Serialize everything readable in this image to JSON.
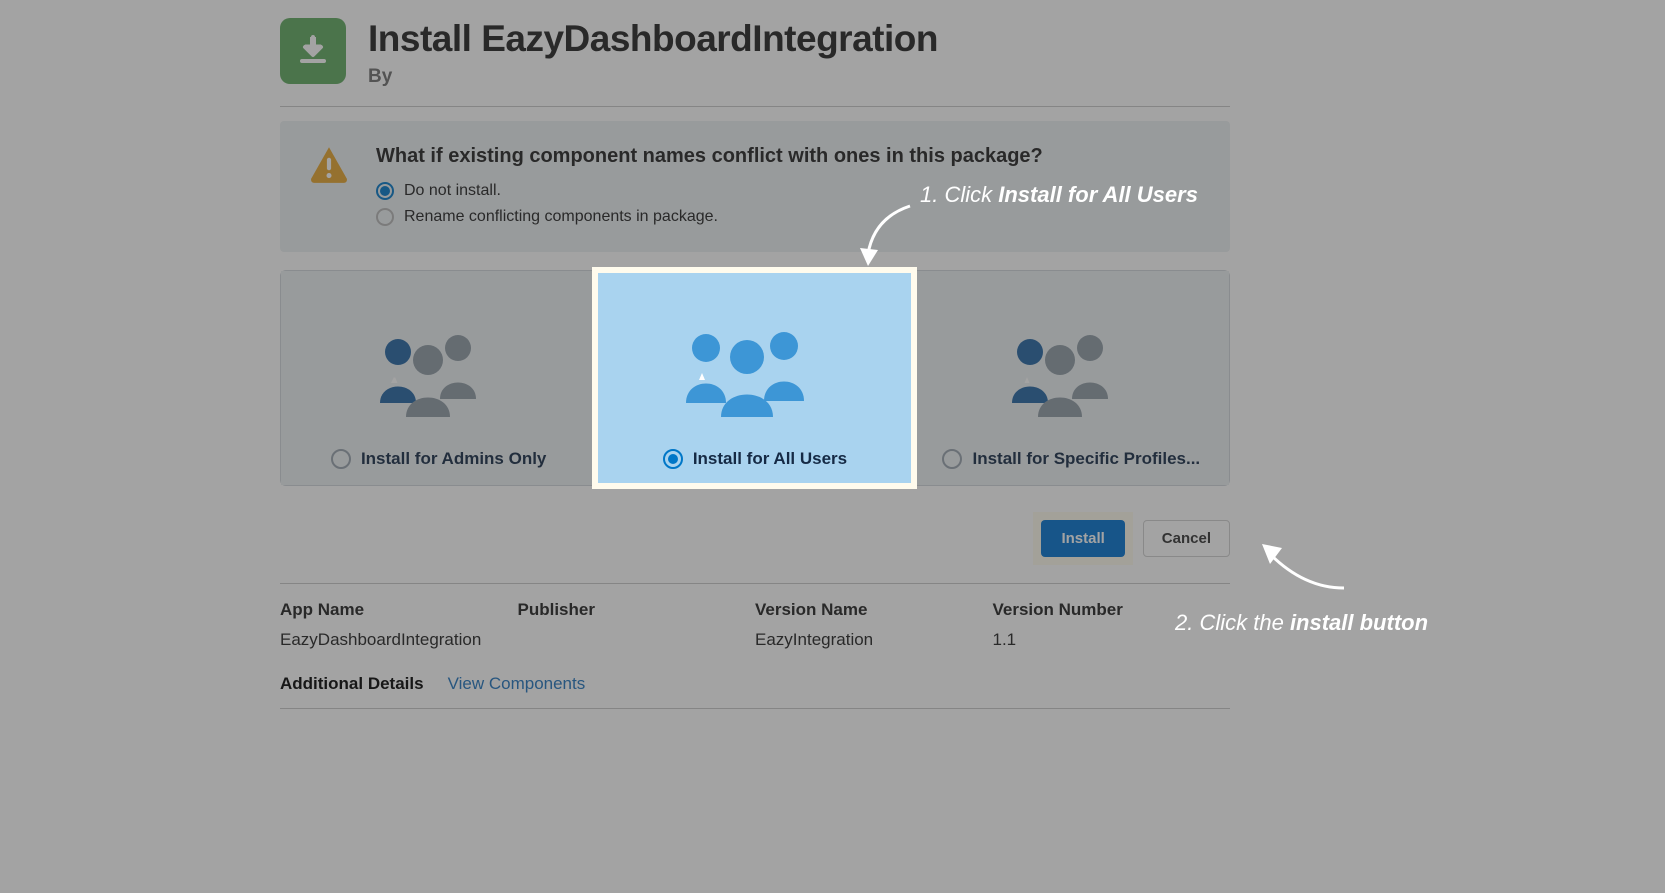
{
  "header": {
    "title": "Install EazyDashboardIntegration",
    "byline": "By"
  },
  "conflict": {
    "question": "What if existing component names conflict with ones in this package?",
    "options": [
      {
        "label": "Do not install.",
        "selected": true
      },
      {
        "label": "Rename conflicting components in package.",
        "selected": false
      }
    ]
  },
  "cards": [
    {
      "label": "Install for Admins Only"
    },
    {
      "label": "Install for All Users"
    },
    {
      "label": "Install for Specific Profiles..."
    }
  ],
  "actions": {
    "install": "Install",
    "cancel": "Cancel"
  },
  "details": {
    "cols": [
      {
        "label": "App Name",
        "value": "EazyDashboardIntegration"
      },
      {
        "label": "Publisher",
        "value": ""
      },
      {
        "label": "Version Name",
        "value": "EazyIntegration"
      },
      {
        "label": "Version Number",
        "value": "1.1"
      }
    ],
    "additional_label": "Additional Details",
    "view_components": "View Components"
  },
  "annotations": {
    "step1_prefix": "1. Click ",
    "step1_bold": "Install for All Users",
    "step2_prefix": "2. Click the ",
    "step2_bold": "install button"
  }
}
